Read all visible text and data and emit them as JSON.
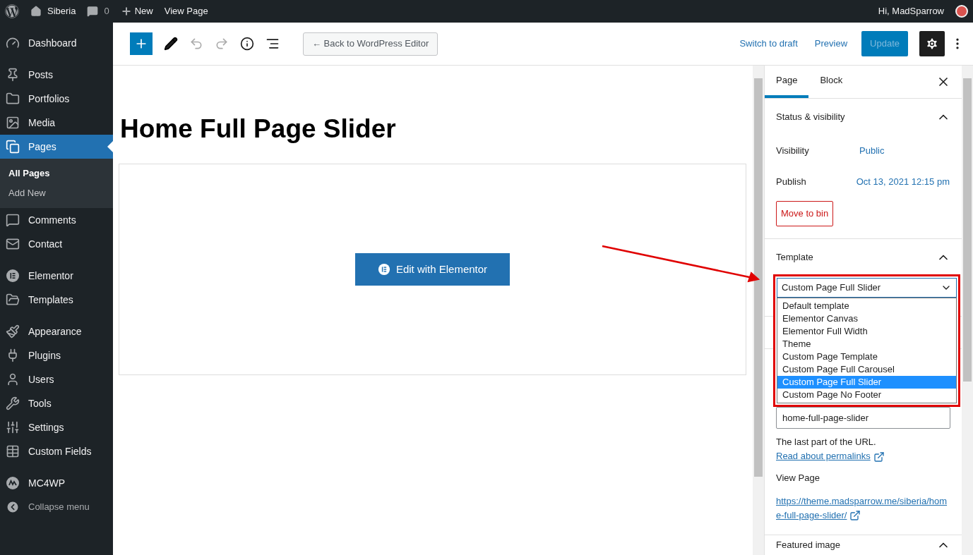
{
  "admin_bar": {
    "site": "Siberia",
    "comments": "0",
    "new": "New",
    "view": "View Page",
    "greeting": "Hi, MadSparrow"
  },
  "sidebar": {
    "groups": [
      [
        {
          "label": "Dashboard",
          "selected": false
        }
      ],
      [
        {
          "label": "Posts",
          "selected": false
        },
        {
          "label": "Portfolios",
          "selected": false
        },
        {
          "label": "Media",
          "selected": false
        },
        {
          "label": "Pages",
          "selected": true,
          "children": [
            {
              "label": "All Pages",
              "selected": true
            },
            {
              "label": "Add New",
              "selected": false
            }
          ]
        },
        {
          "label": "Comments",
          "selected": false
        },
        {
          "label": "Contact",
          "selected": false
        }
      ],
      [
        {
          "label": "Elementor",
          "selected": false
        },
        {
          "label": "Templates",
          "selected": false
        }
      ],
      [
        {
          "label": "Appearance",
          "selected": false
        },
        {
          "label": "Plugins",
          "selected": false
        },
        {
          "label": "Users",
          "selected": false
        },
        {
          "label": "Tools",
          "selected": false
        },
        {
          "label": "Settings",
          "selected": false
        },
        {
          "label": "Custom Fields",
          "selected": false
        }
      ],
      [
        {
          "label": "MC4WP",
          "selected": false
        }
      ]
    ],
    "collapse": "Collapse menu"
  },
  "toolbar": {
    "back": "← Back to WordPress Editor",
    "switch_draft": "Switch to draft",
    "preview": "Preview",
    "update": {
      "label": "Update",
      "disabled": true
    }
  },
  "editor": {
    "title": "Home Full Page Slider",
    "elementor_button": "Edit with Elementor"
  },
  "settings": {
    "tabs": [
      {
        "label": "Page",
        "selected": true
      },
      {
        "label": "Block",
        "selected": false
      }
    ],
    "status": {
      "title": "Status & visibility",
      "expanded": true,
      "rows": [
        {
          "label": "Visibility",
          "value": "Public"
        },
        {
          "label": "Publish",
          "value": "Oct 13, 2021 12:15 pm"
        }
      ],
      "trash": "Move to bin"
    },
    "template": {
      "title": "Template",
      "expanded": true,
      "value": "Custom Page Full Slider",
      "options": [
        {
          "label": "Default template",
          "selected": false
        },
        {
          "label": "Elementor Canvas",
          "selected": false
        },
        {
          "label": "Elementor Full Width",
          "selected": false
        },
        {
          "label": "Theme",
          "selected": false
        },
        {
          "label": "Custom Page Template",
          "selected": false
        },
        {
          "label": "Custom Page Full Carousel",
          "selected": false
        },
        {
          "label": "Custom Page Full Slider",
          "selected": true
        },
        {
          "label": "Custom Page No Footer",
          "selected": false
        }
      ]
    },
    "permalink": {
      "slug": "home-full-page-slider",
      "help": "The last part of the URL.",
      "help_link": "Read about permalinks",
      "view_label": "View Page",
      "url": "https://theme.madsparrow.me/siberia/home-full-page-slider/"
    },
    "featured": {
      "title": "Featured image",
      "expanded": true
    }
  }
}
